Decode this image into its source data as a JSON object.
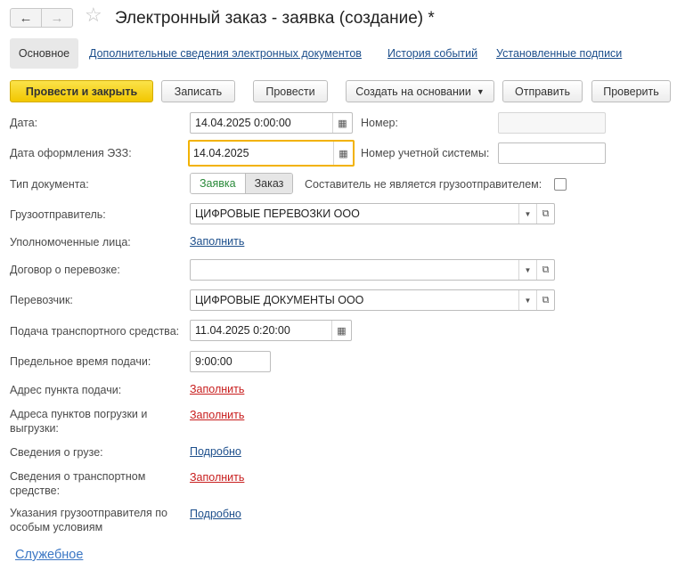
{
  "window": {
    "title": "Электронный заказ - заявка (создание) *",
    "back_icon": "arrow-left-icon",
    "forward_icon": "arrow-right-icon",
    "favorite_icon": "star-icon"
  },
  "tabs": [
    {
      "label": "Основное",
      "active": true
    },
    {
      "label": "Дополнительные сведения электронных документов"
    },
    {
      "label": "История событий"
    },
    {
      "label": "Установленные подписи"
    }
  ],
  "toolbar": {
    "post_close": "Провести и закрыть",
    "save": "Записать",
    "post": "Провести",
    "create_based": "Создать на основании",
    "send": "Отправить",
    "check": "Проверить"
  },
  "form": {
    "date": {
      "label": "Дата:",
      "value": "14.04.2025  0:00:00"
    },
    "number": {
      "label": "Номер:",
      "value": ""
    },
    "ezz_date": {
      "label": "Дата оформления ЭЗЗ:",
      "value": "14.04.2025"
    },
    "account_number": {
      "label": "Номер учетной системы:",
      "value": ""
    },
    "doc_type": {
      "label": "Тип документа:",
      "option_on": "Заявка",
      "option_off": "Заказ"
    },
    "not_shipper": {
      "label": "Составитель не является грузоотправителем:",
      "checked": false
    },
    "shipper": {
      "label": "Грузоотправитель:",
      "value": "ЦИФРОВЫЕ ПЕРЕВОЗКИ ООО"
    },
    "authorized": {
      "label": "Уполномоченные лица:",
      "link": "Заполнить"
    },
    "contract": {
      "label": "Договор о перевозке:",
      "value": ""
    },
    "carrier": {
      "label": "Перевозчик:",
      "value": "ЦИФРОВЫЕ ДОКУМЕНТЫ ООО"
    },
    "vehicle_supply": {
      "label": "Подача транспортного средства:",
      "value": "11.04.2025  0:20:00"
    },
    "deadline": {
      "label": "Предельное время подачи:",
      "value": "9:00:00"
    },
    "supply_address": {
      "label": "Адрес пункта подачи:",
      "link": "Заполнить"
    },
    "load_addresses": {
      "label_line1": "Адреса пунктов погрузки и",
      "label_line2": "выгрузки:",
      "link": "Заполнить"
    },
    "cargo_info": {
      "label": "Сведения о грузе:",
      "link": "Подробно"
    },
    "vehicle_info": {
      "label_line1": "Сведения о транспортном",
      "label_line2": "средстве:",
      "link": "Заполнить"
    },
    "special_conditions": {
      "label_line1": "Указания грузоотправителя по",
      "label_line2": "особым условиям",
      "link": "Подробно"
    }
  },
  "footer": {
    "service": "Служебное"
  },
  "colors": {
    "primary_button": "#f2c700",
    "link": "#1d4f8c",
    "required_link": "#c81e1e",
    "focus_border": "#f2b200",
    "toggle_active_text": "#2a8a3a"
  }
}
